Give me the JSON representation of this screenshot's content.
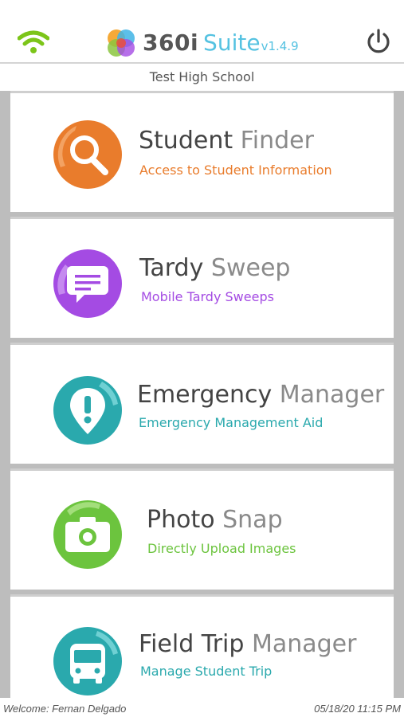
{
  "header": {
    "brand_360": "360i",
    "brand_suite": "Suite",
    "brand_version": "v1.4.9",
    "wifi_icon": "wifi-icon",
    "power_icon": "power-icon",
    "wifi_color": "#7cc519"
  },
  "school": "Test High School",
  "cards": [
    {
      "title_main": "Student",
      "title_light": "Finder",
      "subtitle": "Access to Student Information",
      "color": "#e97c2c",
      "icon": "magnifier-icon"
    },
    {
      "title_main": "Tardy",
      "title_light": "Sweep",
      "subtitle": "Mobile Tardy  Sweeps",
      "color": "#a44be3",
      "icon": "chat-note-icon"
    },
    {
      "title_main": "Emergency",
      "title_light": "Manager",
      "subtitle": "Emergency Management Aid",
      "color": "#2aa9ad",
      "icon": "alert-pin-icon"
    },
    {
      "title_main": "Photo",
      "title_light": "Snap",
      "subtitle": "Directly Upload Images",
      "color": "#6cc43e",
      "icon": "camera-icon"
    },
    {
      "title_main": "Field Trip",
      "title_light": "Manager",
      "subtitle": "Manage Student Trip",
      "color": "#2aa9ad",
      "icon": "bus-icon"
    }
  ],
  "footer": {
    "welcome": "Welcome: Fernan Delgado",
    "timestamp": "05/18/20 11:15 PM"
  }
}
